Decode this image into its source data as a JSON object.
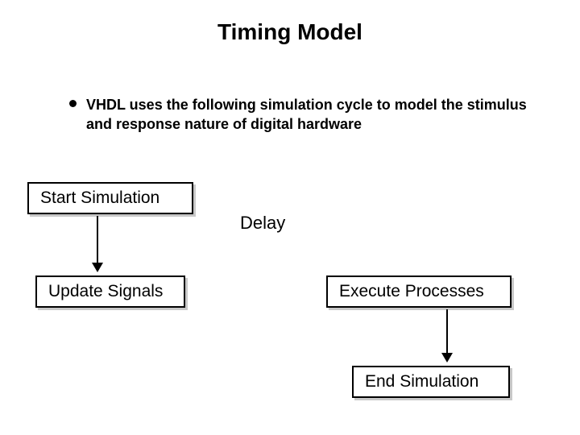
{
  "title": "Timing Model",
  "bullet": "VHDL uses the following simulation cycle to model the stimulus and response nature of digital hardware",
  "boxes": {
    "start": "Start Simulation",
    "update": "Update Signals",
    "execute": "Execute Processes",
    "end": "End Simulation"
  },
  "labels": {
    "delay": "Delay"
  }
}
